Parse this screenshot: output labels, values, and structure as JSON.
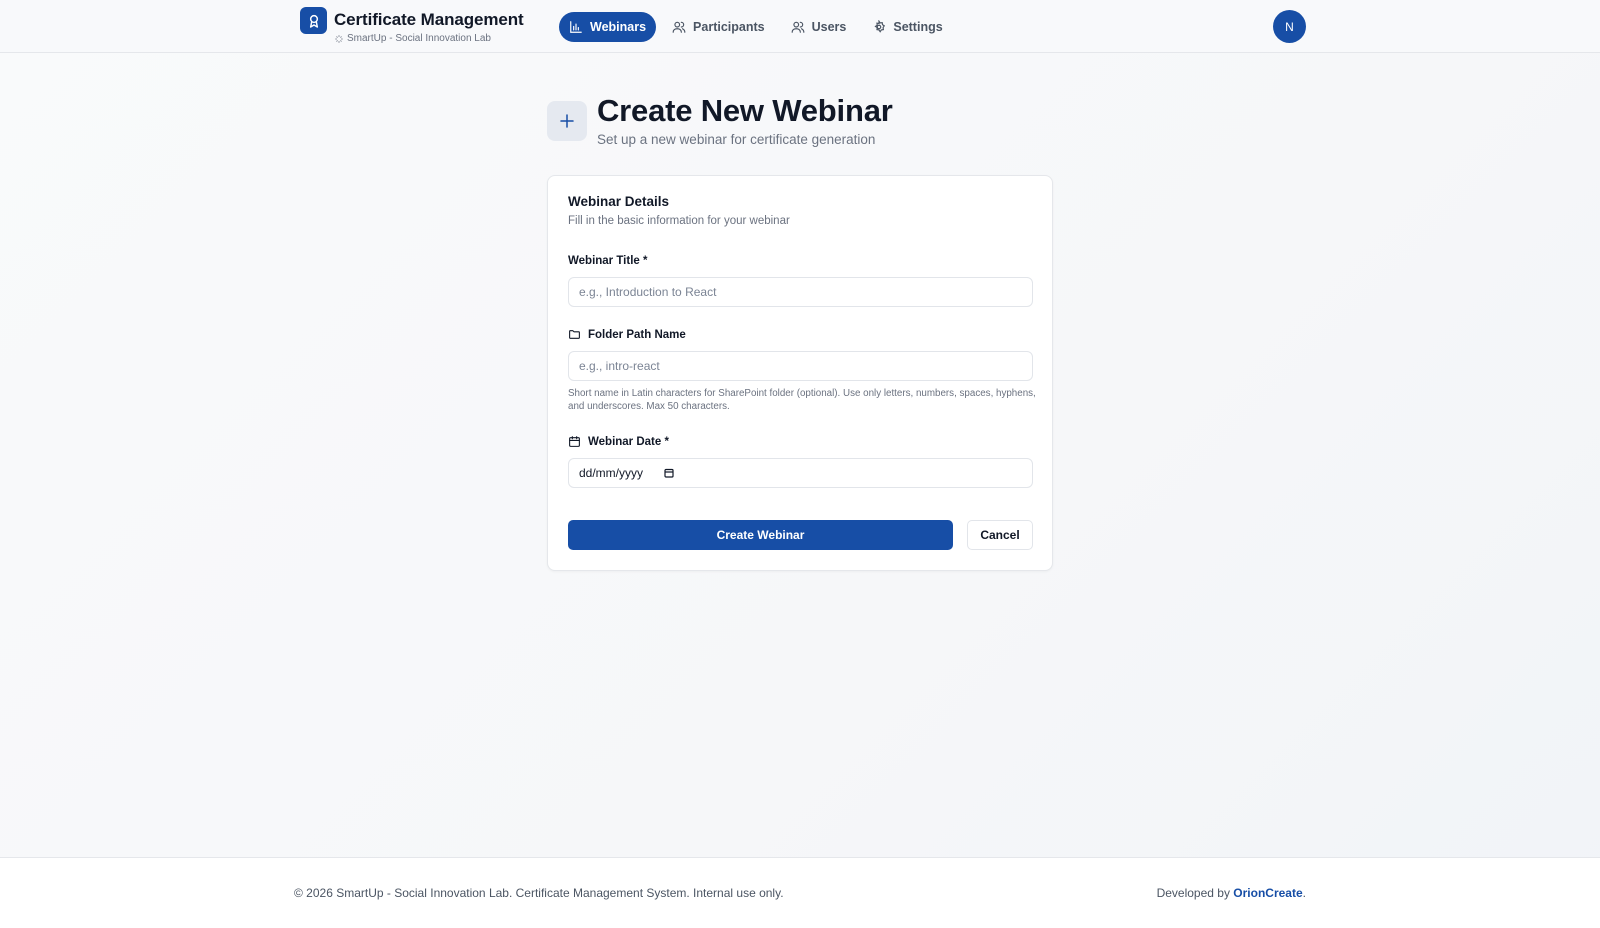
{
  "header": {
    "title": "Certificate Management",
    "subtitle": "SmartUp - Social Innovation Lab",
    "logo_icon": "award-icon",
    "nav": [
      {
        "label": "Webinars",
        "icon": "bar-chart-icon",
        "active": true
      },
      {
        "label": "Participants",
        "icon": "users-icon",
        "active": false
      },
      {
        "label": "Users",
        "icon": "users-icon",
        "active": false
      },
      {
        "label": "Settings",
        "icon": "gear-icon",
        "active": false
      }
    ],
    "avatar_initial": "N"
  },
  "page": {
    "title": "Create New Webinar",
    "subtitle": "Set up a new webinar for certificate generation"
  },
  "form": {
    "card_title": "Webinar Details",
    "card_subtitle": "Fill in the basic information for your webinar",
    "title_label": "Webinar Title *",
    "title_placeholder": "e.g., Introduction to React",
    "folder_label": "Folder Path Name",
    "folder_placeholder": "e.g., intro-react",
    "folder_help": "Short name in Latin characters for SharePoint folder (optional). Use only letters, numbers, spaces, hyphens, and underscores. Max 50 characters.",
    "date_label": "Webinar Date *",
    "date_placeholder": "dd/mm/yyyy",
    "submit_label": "Create Webinar",
    "cancel_label": "Cancel"
  },
  "footer": {
    "copyright": "© 2026 SmartUp - Social Innovation Lab. Certificate Management System. Internal use only.",
    "developed_by": "Developed by ",
    "developer": "OrionCreate",
    "period": "."
  },
  "colors": {
    "primary": "#174ea6",
    "text": "#111827",
    "muted": "#6b7280",
    "border": "#e5e7eb"
  }
}
